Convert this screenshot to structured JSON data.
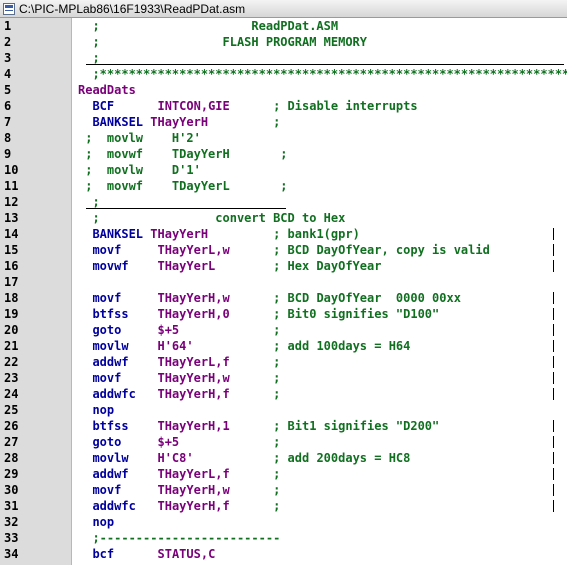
{
  "window": {
    "title": "C:\\PIC-MPLab86\\16F1933\\ReadPDat.asm"
  },
  "lines": [
    {
      "n": "1",
      "t": "  ;                     ReadPDat.ASM"
    },
    {
      "n": "2",
      "t": "  ;                 FLASH PROGRAM MEMORY"
    },
    {
      "n": "3",
      "t": "  ;"
    },
    {
      "n": "4",
      "t": "  ;*****************************************************************"
    },
    {
      "n": "5",
      "t": "ReadDats"
    },
    {
      "n": "6",
      "t": "  BCF      INTCON,GIE      ; Disable interrupts"
    },
    {
      "n": "7",
      "t": "  BANKSEL THayYerH         ;"
    },
    {
      "n": "8",
      "t": " ;  movlw    H'2'"
    },
    {
      "n": "9",
      "t": " ;  movwf    TDayYerH       ;"
    },
    {
      "n": "10",
      "t": " ;  movlw    D'1'"
    },
    {
      "n": "11",
      "t": " ;  movwf    TDayYerL       ;"
    },
    {
      "n": "12",
      "t": "  ;"
    },
    {
      "n": "13",
      "t": "  ;                convert BCD to Hex"
    },
    {
      "n": "14",
      "t": "  BANKSEL THayYerH         ; bank1(gpr)"
    },
    {
      "n": "15",
      "t": "  movf     THayYerL,w      ; BCD DayOfYear, copy is valid"
    },
    {
      "n": "16",
      "t": "  movwf    THayYerL        ; Hex DayOfYear"
    },
    {
      "n": "17",
      "t": ""
    },
    {
      "n": "18",
      "t": "  movf     THayYerH,w      ; BCD DayOfYear  0000 00xx"
    },
    {
      "n": "19",
      "t": "  btfss    THayYerH,0      ; Bit0 signifies \"D100\""
    },
    {
      "n": "20",
      "t": "  goto     $+5             ;"
    },
    {
      "n": "21",
      "t": "  movlw    H'64'           ; add 100days = H64"
    },
    {
      "n": "22",
      "t": "  addwf    THayYerL,f      ;"
    },
    {
      "n": "23",
      "t": "  movf     THayYerH,w      ;"
    },
    {
      "n": "24",
      "t": "  addwfc   THayYerH,f      ;"
    },
    {
      "n": "25",
      "t": "  nop"
    },
    {
      "n": "26",
      "t": "  btfss    THayYerH,1      ; Bit1 signifies \"D200\""
    },
    {
      "n": "27",
      "t": "  goto     $+5             ;"
    },
    {
      "n": "28",
      "t": "  movlw    H'C8'           ; add 200days = HC8"
    },
    {
      "n": "29",
      "t": "  addwf    THayYerL,f      ;"
    },
    {
      "n": "30",
      "t": "  movf     THayYerH,w      ;"
    },
    {
      "n": "31",
      "t": "  addwfc   THayYerH,f      ;"
    },
    {
      "n": "32",
      "t": "  nop"
    },
    {
      "n": "33",
      "t": "  ;-------------------------"
    },
    {
      "n": "34",
      "t": "  bcf      STATUS,C"
    }
  ],
  "colors": {
    "comment": "#107020",
    "instruction": "#0000a0",
    "register": "#7a007a",
    "gutter": "#dcdcdc"
  }
}
